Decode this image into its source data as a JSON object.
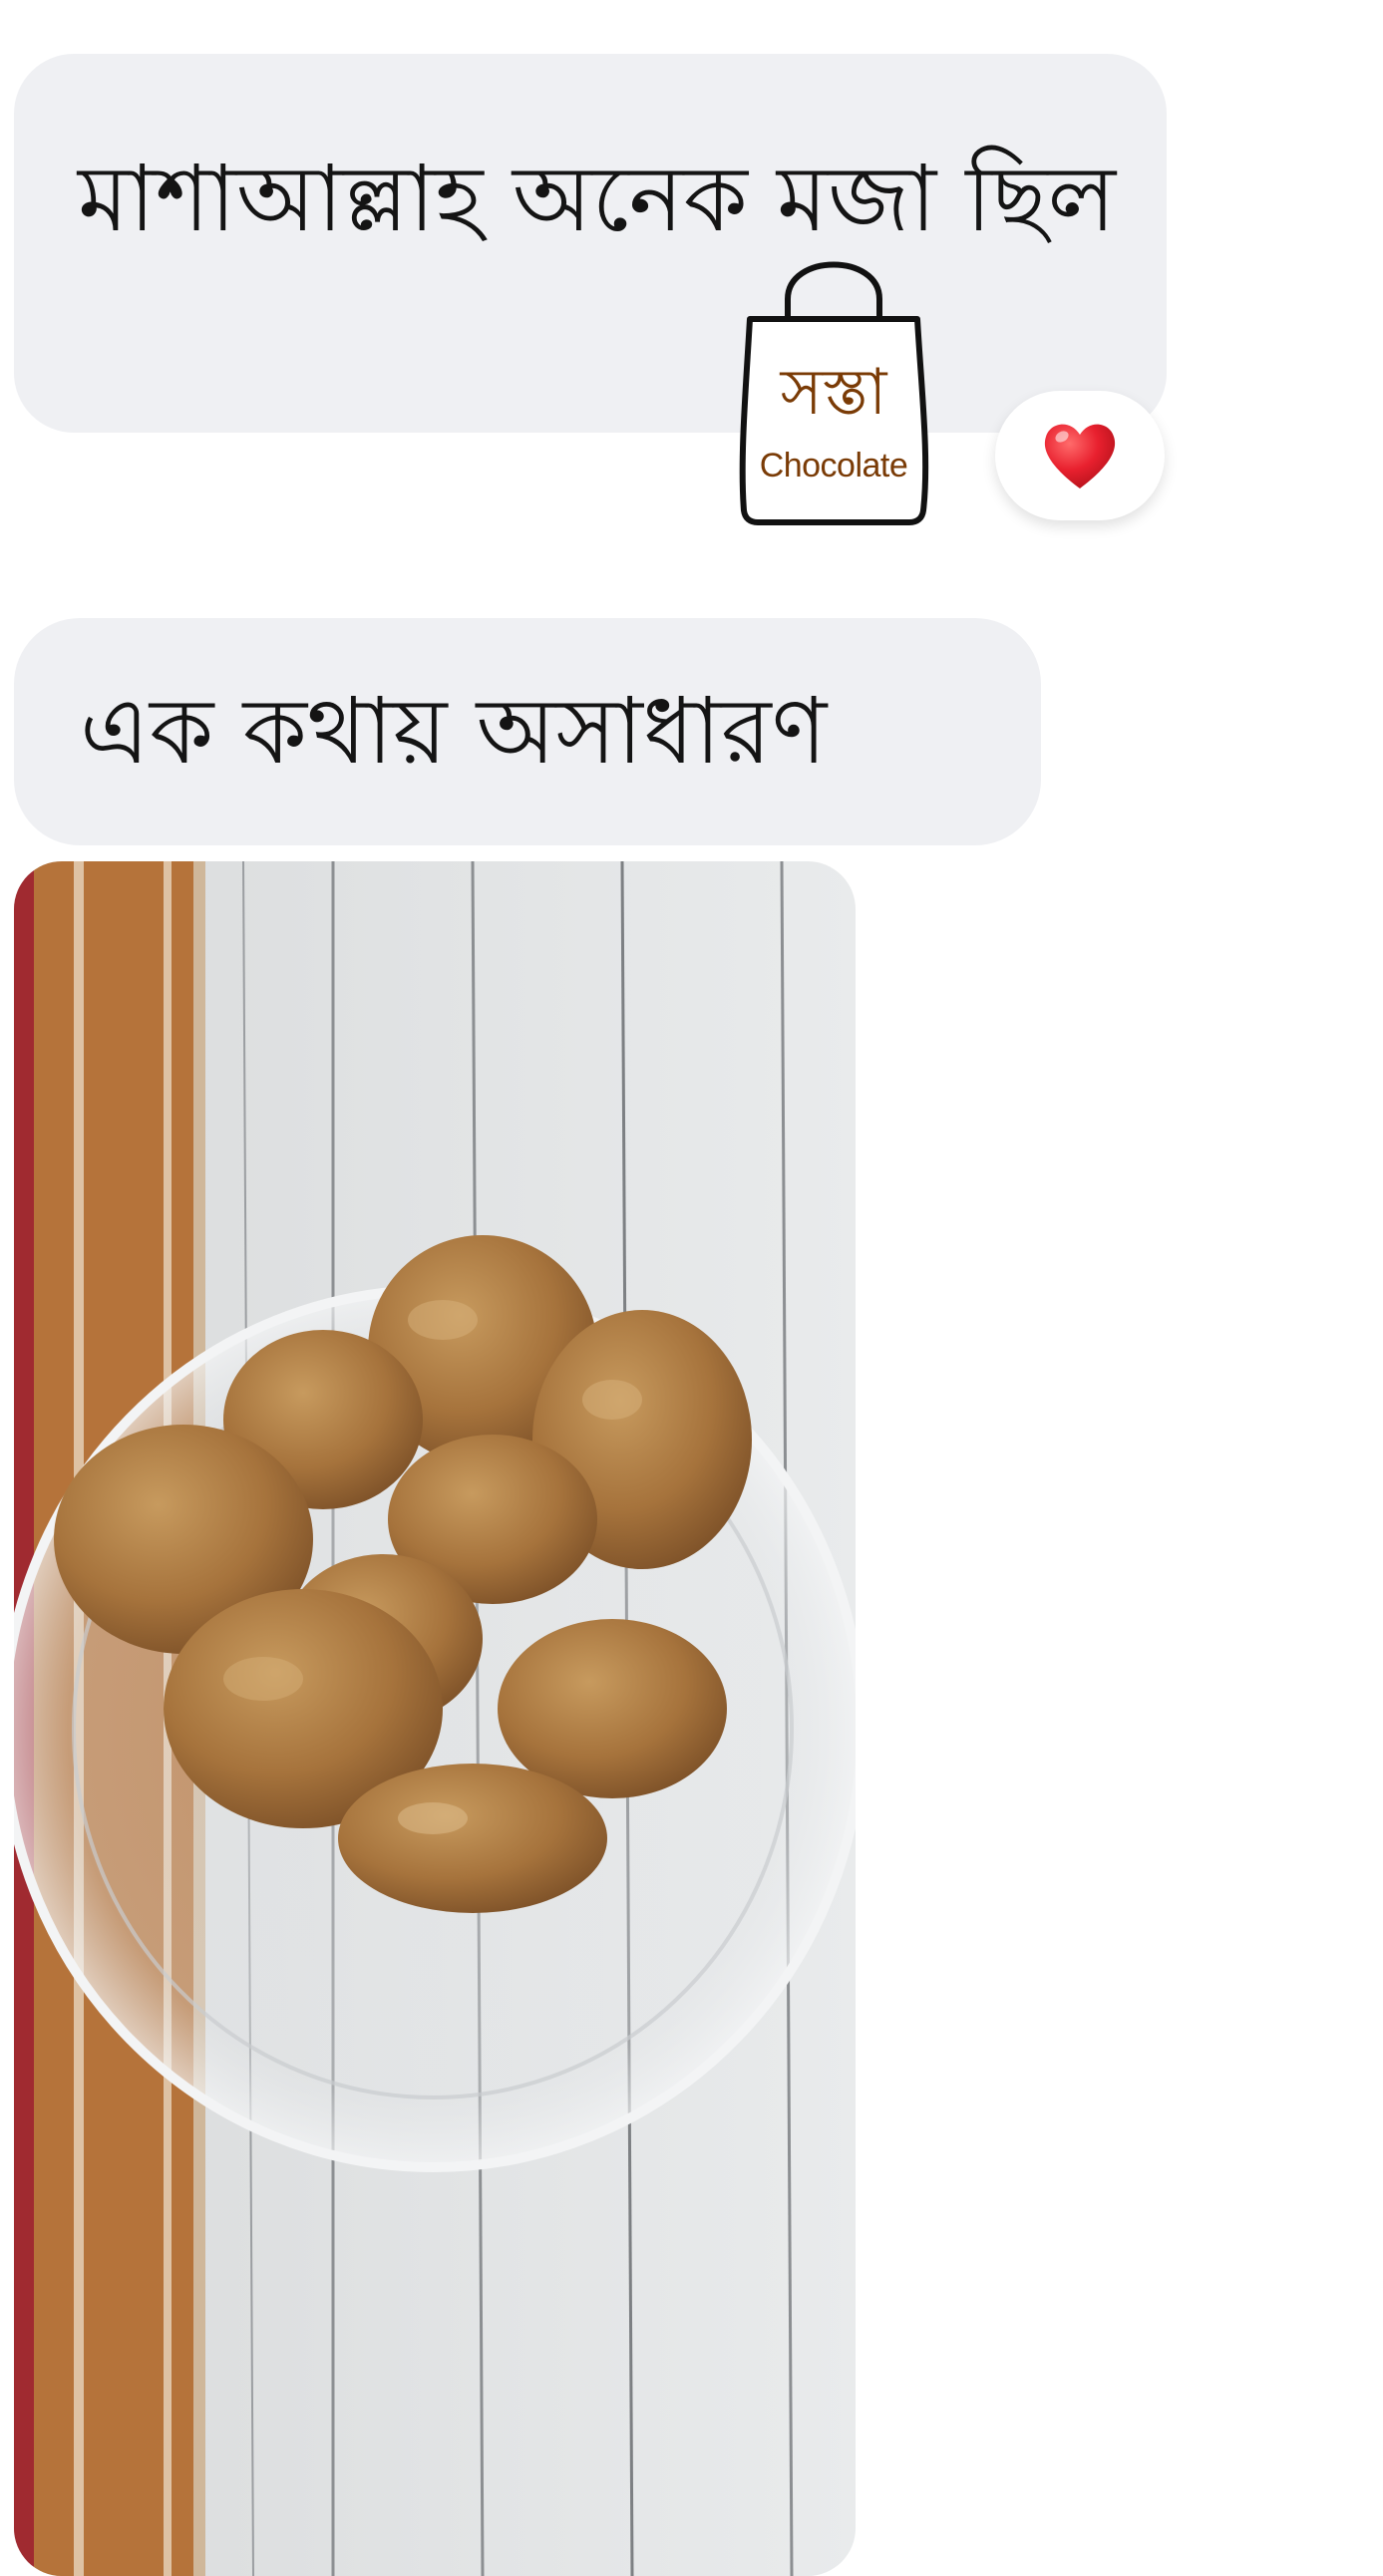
{
  "messages": [
    {
      "text": "মাশাআল্লাহ অনেক মজা ছিল",
      "reaction": "heart-emoji"
    },
    {
      "text": "এক কথায় অসাধারণ"
    }
  ],
  "watermark": {
    "bengali": "সস্তা",
    "english": "Chocolate",
    "icon": "shopping-bag-icon"
  },
  "photo": {
    "subject": "chocolate-cookies-in-plastic-bowl-photo"
  },
  "colors": {
    "bubble_bg": "#eff0f3",
    "text": "#141414",
    "heart": "#e8202e",
    "logo_text": "#7a3b06"
  }
}
